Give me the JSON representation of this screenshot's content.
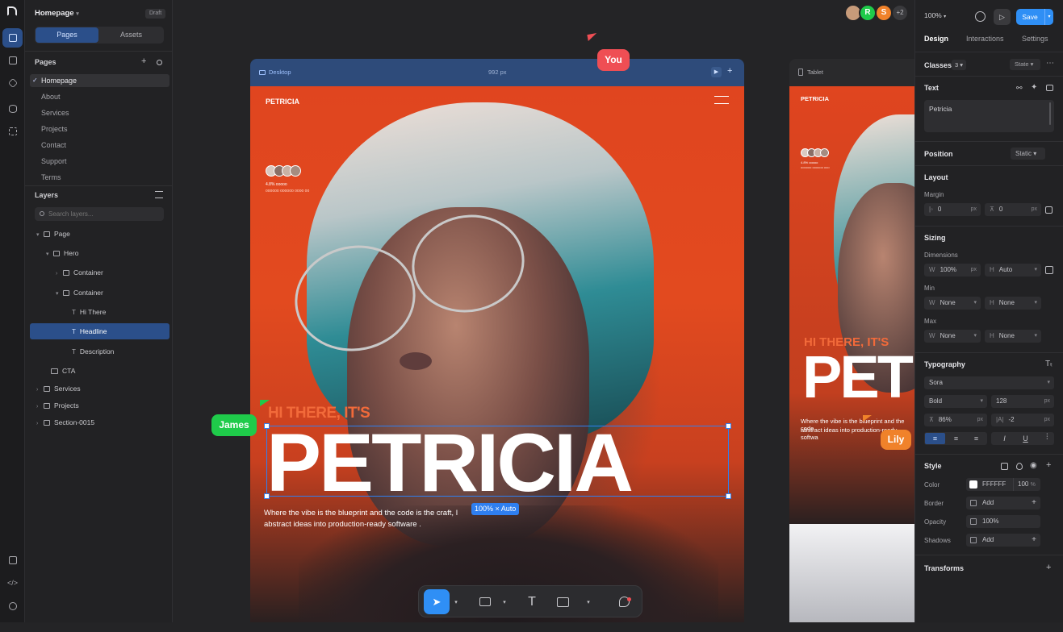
{
  "rail": {
    "icons": [
      "pages-icon",
      "add-icon",
      "cube-icon",
      "database-icon",
      "components-icon",
      "layout-icon",
      "code-icon",
      "help-icon"
    ]
  },
  "left": {
    "page_name": "Homepage",
    "draft_badge": "Draft",
    "tabs": {
      "pages": "Pages",
      "assets": "Assets"
    },
    "pages_title": "Pages",
    "pages": [
      "Homepage",
      "About",
      "Services",
      "Projects",
      "Contact",
      "Support",
      "Terms"
    ],
    "layers_title": "Layers",
    "search_placeholder": "Search layers...",
    "layers": [
      "Page",
      "Hero",
      "Container",
      "Container",
      "Hi There",
      "Headline",
      "Description",
      "CTA",
      "Services",
      "Projects",
      "Section-0015"
    ]
  },
  "topbar": {
    "zoom": "100%",
    "save": "Save",
    "avatar_r": "R",
    "avatar_s": "S",
    "more": "+2"
  },
  "cursors": {
    "you": "You",
    "james": "James",
    "lily": "Lily"
  },
  "desktop": {
    "label": "Desktop",
    "width": "992 px",
    "brand": "PETRICIA",
    "social_line1": "4.8% ooooo",
    "social_line2": "oooooo oooooo  oooo oo",
    "kicker": "HI THERE, IT'S",
    "headline": "PETRICIA",
    "desc1": "Where the vibe is the blueprint and the code is the craft, I",
    "desc2": "abstract ideas into production-ready software .",
    "size_badge": "100% × Auto"
  },
  "tablet": {
    "label": "Tablet",
    "brand": "PETRICIA",
    "kicker": "HI THERE, IT'S",
    "headline": "PET",
    "desc1": "Where the vibe is the blueprint and the code",
    "desc2": "abstract ideas into production-ready softwa",
    "social_line1": "4.8% ooooo",
    "social_line2": "oooooo oooooo  ooo"
  },
  "right": {
    "tabs": {
      "design": "Design",
      "interactions": "Interactions",
      "settings": "Settings"
    },
    "classes": "Classes",
    "classes_count": "3",
    "state": "State",
    "text_title": "Text",
    "text_value": "Petricia",
    "position": "Position",
    "position_value": "Static",
    "layout": "Layout",
    "margin": "Margin",
    "margin_x": "0",
    "margin_y": "0",
    "px": "px",
    "sizing": "Sizing",
    "dimensions": "Dimensions",
    "w": "W",
    "h": "H",
    "w_val": "100%",
    "h_val": "Auto",
    "min": "Min",
    "max": "Max",
    "none": "None",
    "typography": "Typography",
    "font": "Sora",
    "weight": "Bold",
    "size": "128",
    "line_height": "86%",
    "letter": "-2",
    "style": "Style",
    "color": "Color",
    "color_hex": "FFFFFF",
    "color_pct": "100",
    "pct": "%",
    "border": "Border",
    "add": "Add",
    "opacity": "Opacity",
    "opacity_val": "100%",
    "shadows": "Shadows",
    "transforms": "Transforms"
  },
  "colors": {
    "accent": "#2f7ff0",
    "hero": "#e2471f",
    "james": "#1fcb4a",
    "you": "#ef4e54",
    "lily": "#f0822a"
  }
}
